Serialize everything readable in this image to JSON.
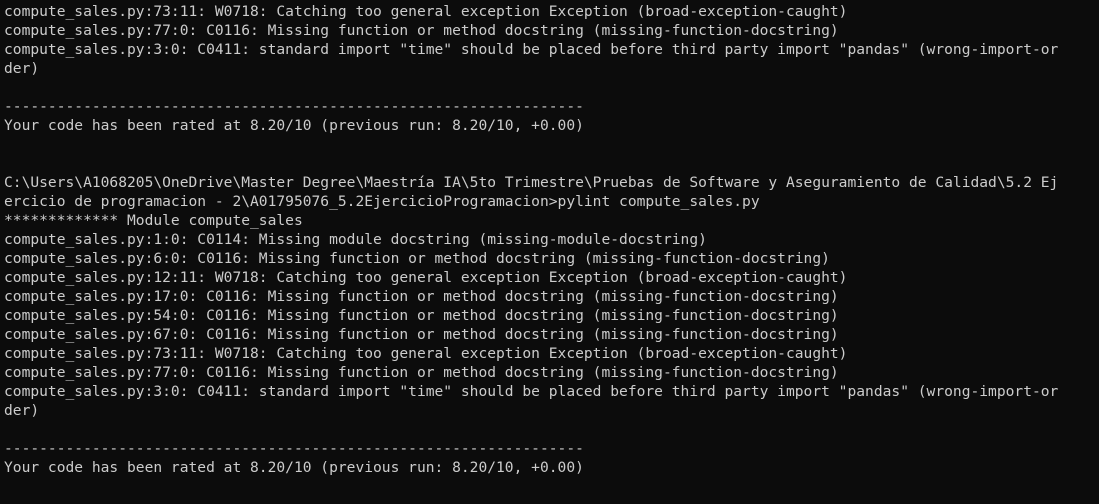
{
  "terminal": {
    "background": "#0c0c0c",
    "foreground": "#cccccc",
    "lines": [
      "compute_sales.py:73:11: W0718: Catching too general exception Exception (broad-exception-caught)",
      "compute_sales.py:77:0: C0116: Missing function or method docstring (missing-function-docstring)",
      "compute_sales.py:3:0: C0411: standard import \"time\" should be placed before third party import \"pandas\" (wrong-import-or",
      "der)",
      "",
      "------------------------------------------------------------------",
      "Your code has been rated at 8.20/10 (previous run: 8.20/10, +0.00)",
      "",
      "",
      "C:\\Users\\A1068205\\OneDrive\\Master Degree\\Maestría IA\\5to Trimestre\\Pruebas de Software y Aseguramiento de Calidad\\5.2 Ej",
      "ercicio de programacion - 2\\A01795076_5.2EjercicioProgramacion>pylint compute_sales.py",
      "************* Module compute_sales",
      "compute_sales.py:1:0: C0114: Missing module docstring (missing-module-docstring)",
      "compute_sales.py:6:0: C0116: Missing function or method docstring (missing-function-docstring)",
      "compute_sales.py:12:11: W0718: Catching too general exception Exception (broad-exception-caught)",
      "compute_sales.py:17:0: C0116: Missing function or method docstring (missing-function-docstring)",
      "compute_sales.py:54:0: C0116: Missing function or method docstring (missing-function-docstring)",
      "compute_sales.py:67:0: C0116: Missing function or method docstring (missing-function-docstring)",
      "compute_sales.py:73:11: W0718: Catching too general exception Exception (broad-exception-caught)",
      "compute_sales.py:77:0: C0116: Missing function or method docstring (missing-function-docstring)",
      "compute_sales.py:3:0: C0411: standard import \"time\" should be placed before third party import \"pandas\" (wrong-import-or",
      "der)",
      "",
      "------------------------------------------------------------------",
      "Your code has been rated at 8.20/10 (previous run: 8.20/10, +0.00)"
    ]
  }
}
